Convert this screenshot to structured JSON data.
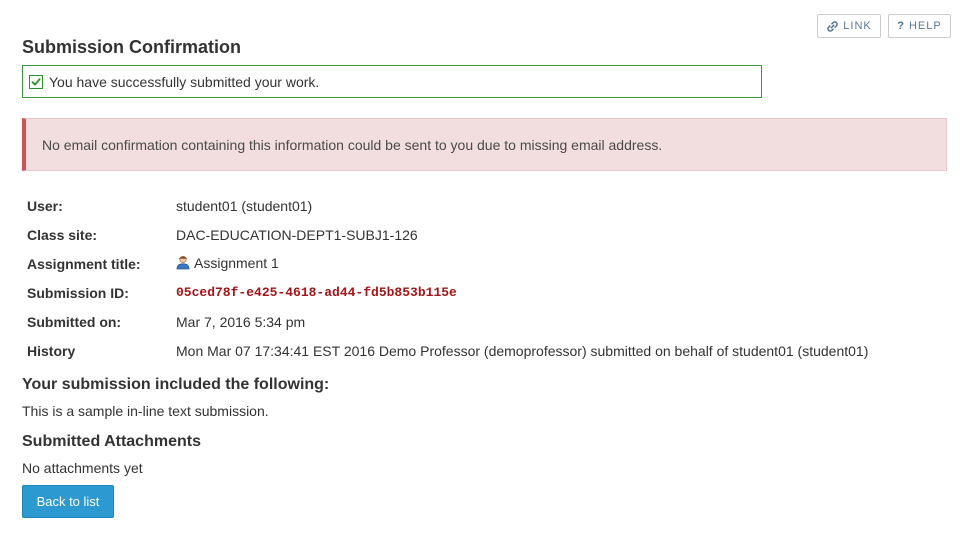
{
  "toolbar": {
    "link_label": "LINK",
    "link_icon": "link-icon",
    "help_label": "HELP",
    "help_icon": "question-mark-icon",
    "help_icon_text": "?"
  },
  "page_title": "Submission Confirmation",
  "success_message": {
    "icon": "checkbox-checked-icon",
    "text": "You have successfully submitted your work."
  },
  "warning_message": "No email confirmation containing this information could be sent to you due to missing email address.",
  "details": {
    "user": {
      "label": "User:",
      "value": "student01 (student01)"
    },
    "class_site": {
      "label": "Class site:",
      "value": "DAC-EDUCATION-DEPT1-SUBJ1-126"
    },
    "assignment_title": {
      "label": "Assignment title:",
      "value": "Assignment 1",
      "icon": "person-icon"
    },
    "submission_id": {
      "label": "Submission ID:",
      "value": "05ced78f-e425-4618-ad44-fd5b853b115e"
    },
    "submitted_on": {
      "label": "Submitted on:",
      "value": "Mar 7, 2016 5:34 pm"
    },
    "history": {
      "label": "History",
      "value": "Mon Mar 07 17:34:41 EST 2016 Demo Professor (demoprofessor) submitted on behalf of student01 (student01)"
    }
  },
  "submission_section": {
    "heading": "Your submission included the following:",
    "text": "This is a sample in-line text submission."
  },
  "attachments_section": {
    "heading": "Submitted Attachments",
    "text": "No attachments yet"
  },
  "back_button_label": "Back to list",
  "colors": {
    "success_border": "#3c9a3c",
    "warning_background": "#f2dede",
    "warning_accent": "#c9545a",
    "submission_id_text": "#a1161a",
    "primary_button": "#2c9ad0"
  }
}
